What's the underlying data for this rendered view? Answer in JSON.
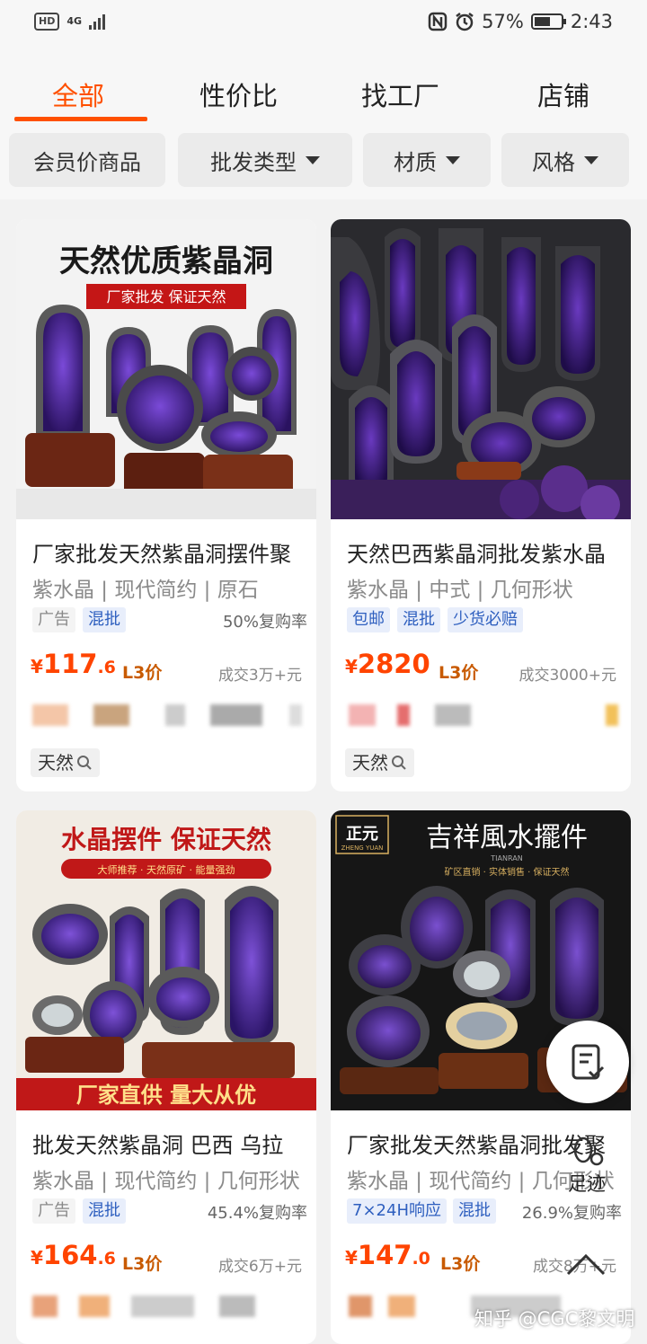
{
  "status_bar": {
    "network_label": "HD",
    "net_gen": "4G",
    "battery": "57%",
    "time": "2:43"
  },
  "tabs": [
    {
      "label": "全部",
      "active": true
    },
    {
      "label": "性价比"
    },
    {
      "label": "找工厂"
    },
    {
      "label": "店铺"
    }
  ],
  "filters": [
    {
      "label": "会员价商品"
    },
    {
      "label": "批发类型",
      "dropdown": true
    },
    {
      "label": "材质",
      "dropdown": true
    },
    {
      "label": "风格",
      "dropdown": true
    }
  ],
  "products": [
    {
      "banner_title": "天然优质紫晶洞",
      "banner_sub": "厂家批发 保证天然",
      "title": "厂家批发天然紫晶洞摆件聚",
      "attrs": "紫水晶 | 现代简约 | 原石",
      "tags": [
        "广告",
        "混批"
      ],
      "rebuy": "50%复购率",
      "price_currency": "¥",
      "price_int": "117",
      "price_dec": ".6",
      "price_level": "L3价",
      "sold": "成交3万+元",
      "keyword": "天然"
    },
    {
      "title": "天然巴西紫晶洞批发紫水晶",
      "attrs": "紫水晶 | 中式 | 几何形状",
      "tags": [
        "包邮",
        "混批",
        "少货必赔"
      ],
      "rebuy": "",
      "price_currency": "¥",
      "price_int": "2820",
      "price_dec": "",
      "price_level": "L3价",
      "sold": "成交3000+元",
      "keyword": "天然"
    },
    {
      "banner_title": "水晶摆件 保证天然",
      "banner_sub": "大师推荐 · 天然原矿 · 能量强劲",
      "banner_bottom": "厂家直供 量大从优",
      "title": "批发天然紫晶洞 巴西 乌拉",
      "attrs": "紫水晶 | 现代简约 | 几何形状",
      "tags": [
        "广告",
        "混批"
      ],
      "rebuy": "45.4%复购率",
      "price_currency": "¥",
      "price_int": "164",
      "price_dec": ".6",
      "price_level": "L3价",
      "sold": "成交6万+元"
    },
    {
      "banner_brand": "正元",
      "banner_brand_en": "ZHENG YUAN",
      "banner_title": "吉祥風水擺件",
      "banner_en": "TIANRAN",
      "banner_sub": "矿区直销 · 实体销售 · 保证天然",
      "title": "厂家批发天然紫晶洞批发聚",
      "attrs": "紫水晶 | 现代简约 | 几何形状",
      "tags": [
        "7×24H响应",
        "混批"
      ],
      "rebuy": "26.9%复购率",
      "price_currency": "¥",
      "price_int": "147",
      "price_dec": ".0",
      "price_level": "L3价",
      "sold": "成交8万+元"
    }
  ],
  "floating": {
    "footprint_label": "足迹"
  },
  "watermark": "知乎 @CGC黎文明",
  "colors": {
    "accent": "#ff5000",
    "price": "#ff4400",
    "tag_blue": "#2e5fbf",
    "amethyst": "#4a2a8c"
  }
}
